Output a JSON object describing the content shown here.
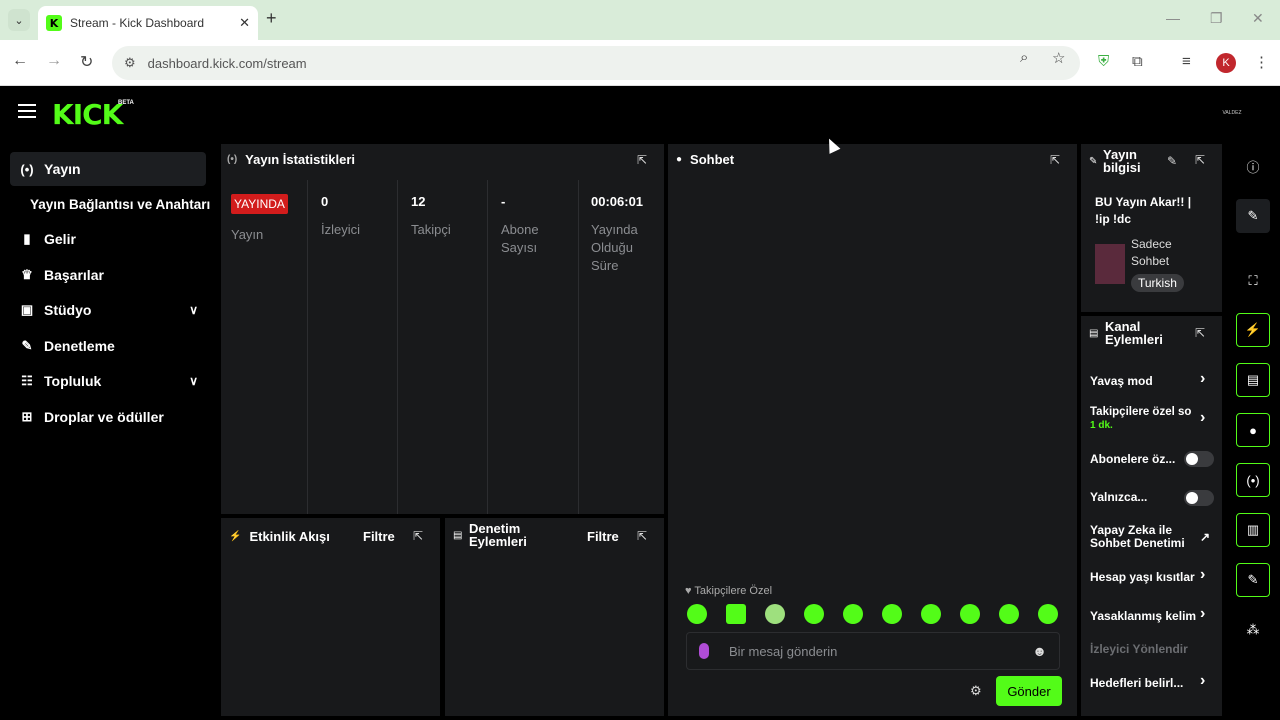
{
  "browser": {
    "tab_title": "Stream - Kick Dashboard",
    "favicon_letter": "K",
    "url": "dashboard.kick.com/stream",
    "profile_letter": "K"
  },
  "header": {
    "logo": "KICK",
    "logo_badge": "BETA",
    "avatar_text": "VALDEZ"
  },
  "sidebar": {
    "items": [
      {
        "label": "Yayın",
        "icon": "broadcast-icon"
      },
      {
        "label": "Yayın Bağlantısı ve Anahtarı",
        "icon": ""
      },
      {
        "label": "Gelir",
        "icon": "chart-icon"
      },
      {
        "label": "Başarılar",
        "icon": "trophy-icon"
      },
      {
        "label": "Stüdyo",
        "icon": "studio-icon"
      },
      {
        "label": "Denetleme",
        "icon": "wrench-icon"
      },
      {
        "label": "Topluluk",
        "icon": "community-icon"
      },
      {
        "label": "Droplar ve ödüller",
        "icon": "gift-icon"
      }
    ]
  },
  "stats": {
    "title": "Yayın İstatistikleri",
    "live_badge": "YAYINDA",
    "live_label": "Yayın",
    "viewers_value": "0",
    "viewers_label": "İzleyici",
    "followers_value": "12",
    "followers_label": "Takipçi",
    "subs_value": "-",
    "subs_label_1": "Abone",
    "subs_label_2": "Sayısı",
    "uptime_value": "00:06:01",
    "uptime_label_1": "Yayında",
    "uptime_label_2": "Olduğu",
    "uptime_label_3": "Süre"
  },
  "activity": {
    "title": "Etkinlik Akışı",
    "filter": "Filtre"
  },
  "moderation": {
    "title_1": "Denetim",
    "title_2": "Eylemleri",
    "filter": "Filtre"
  },
  "chat": {
    "title": "Sohbet",
    "mode_label": "Takipçilere Özel",
    "placeholder": "Bir mesaj gönderin",
    "send_label": "Gönder"
  },
  "stream_info": {
    "title_1": "Yayın",
    "title_2": "bilgisi",
    "stream_title_1": "BU Yayın Akar!! |",
    "stream_title_2": "!ip !dc",
    "category_1": "Sadece",
    "category_2": "Sohbet",
    "language": "Turkish"
  },
  "channel_actions": {
    "title_1": "Kanal",
    "title_2": "Eylemleri",
    "slow_mode": "Yavaş mod",
    "followers_only": "Takipçilere özel so",
    "followers_only_value": "1 dk.",
    "subs_only": "Abonelere öz...",
    "emotes_only": "Yalnızca...",
    "ai_mod_1": "Yapay Zeka ile",
    "ai_mod_2": "Sohbet Denetimi",
    "age_restrict": "Hesap yaşı kısıtlar",
    "banned_words": "Yasaklanmış kelim",
    "viewer_redirect": "İzleyici Yönlendir",
    "goals": "Hedefleri belirl..."
  },
  "colors": {
    "accent": "#53fc18",
    "live": "#d21c1c",
    "panel": "#18191b"
  }
}
